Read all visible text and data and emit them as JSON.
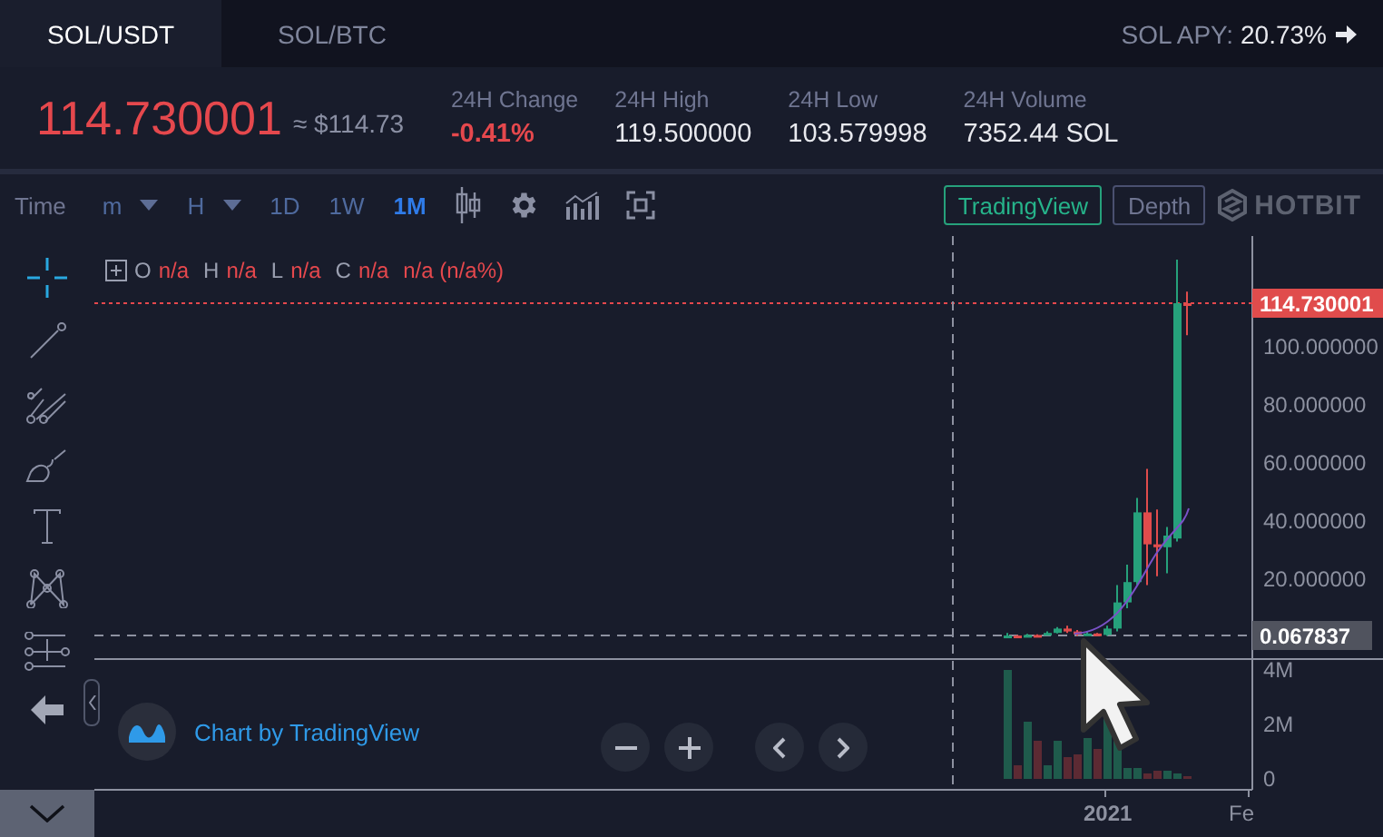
{
  "tabs": [
    {
      "label": "SOL/USDT",
      "selected": true
    },
    {
      "label": "SOL/BTC",
      "selected": false
    }
  ],
  "apy": {
    "label": "SOL APY:",
    "value": "20.73%"
  },
  "ticker": {
    "price": "114.730001",
    "approx": "≈ $114.73"
  },
  "stats": [
    {
      "label": "24H Change",
      "value": "-0.41%",
      "kind": "down"
    },
    {
      "label": "24H High",
      "value": "119.500000",
      "kind": "plain"
    },
    {
      "label": "24H Low",
      "value": "103.579998",
      "kind": "plain"
    },
    {
      "label": "24H Volume",
      "value": "7352.44 SOL",
      "kind": "plain"
    }
  ],
  "toolbar": {
    "label": "Time",
    "intervals": [
      {
        "label": "m",
        "dropdown": true,
        "selected": false
      },
      {
        "label": "H",
        "dropdown": true,
        "selected": false
      },
      {
        "label": "1D",
        "dropdown": false,
        "selected": false
      },
      {
        "label": "1W",
        "dropdown": false,
        "selected": false
      },
      {
        "label": "1M",
        "dropdown": false,
        "selected": true
      }
    ]
  },
  "views": [
    {
      "label": "TradingView",
      "selected": true
    },
    {
      "label": "Depth",
      "selected": false
    }
  ],
  "logo": "HOTBIT",
  "legend": [
    {
      "label": "O",
      "value": "n/a"
    },
    {
      "label": "H",
      "value": "n/a"
    },
    {
      "label": "L",
      "value": "n/a"
    },
    {
      "label": "C",
      "value": "n/a"
    }
  ],
  "legend_change": "n/a (n/a%)",
  "price_axis": [
    "100.000000",
    "80.000000",
    "60.000000",
    "40.000000",
    "20.000000"
  ],
  "last_price_label": "114.730001",
  "low_label": "0.067837",
  "volume_axis": [
    "4M",
    "2M",
    "0"
  ],
  "time_axis": [
    "2021",
    "Fe"
  ],
  "attribution": "Chart by TradingView"
}
